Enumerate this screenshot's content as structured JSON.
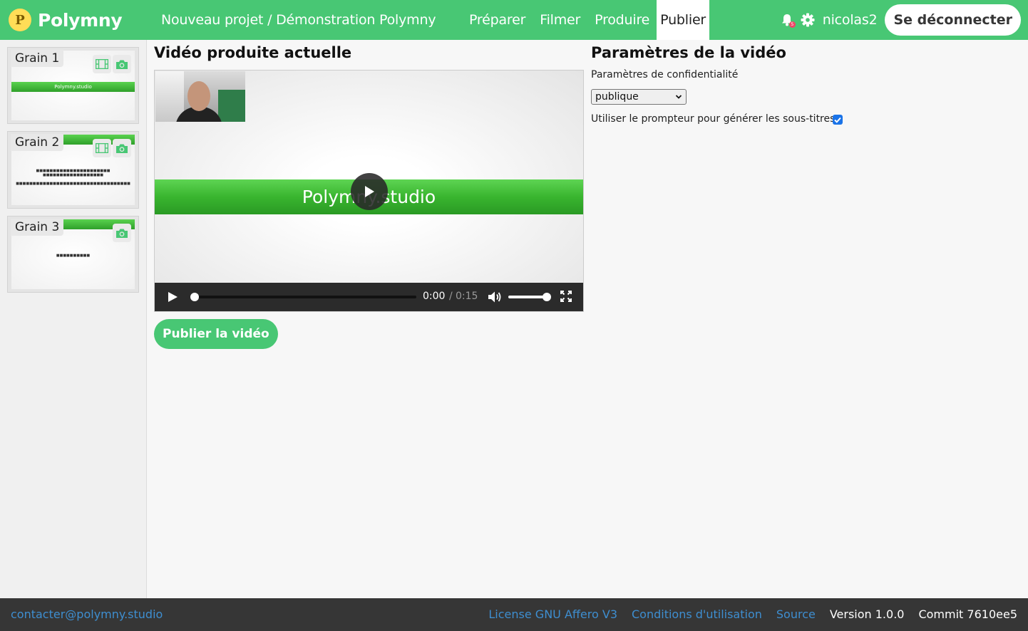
{
  "navbar": {
    "brand_logo": "P",
    "brand": "Polymny",
    "project": "Nouveau projet / Démonstration Polymny",
    "tabs": [
      "Préparer",
      "Filmer",
      "Produire",
      "Publier"
    ],
    "active_tab": "Publier",
    "notification_count": "5",
    "username": "nicolas2",
    "logout": "Se déconnecter",
    "accent_color": "#48c774"
  },
  "sidebar": {
    "grains": [
      {
        "label": "Grain 1",
        "slide_banner": "Polymny.studio",
        "icons": [
          "film-icon",
          "camera-icon"
        ]
      },
      {
        "label": "Grain 2",
        "icons": [
          "film-icon",
          "camera-icon"
        ]
      },
      {
        "label": "Grain 3",
        "icons": [
          "camera-icon"
        ]
      }
    ]
  },
  "main": {
    "title": "Vidéo produite actuelle",
    "video": {
      "slide_banner": "Polymny.studio",
      "time_current": "0:00",
      "time_separator": "/",
      "time_total": "0:15",
      "progress": 0,
      "volume": 1
    },
    "publish_button": "Publier la vidéo"
  },
  "settings": {
    "title": "Paramètres de la vidéo",
    "privacy_label": "Paramètres de confidentialité",
    "privacy_value": "publique",
    "prompter_label": "Utiliser le prompteur pour générer les sous-titres",
    "prompter_checked": true
  },
  "footer": {
    "contact": "contacter@polymny.studio",
    "license": "License GNU Affero V3",
    "terms": "Conditions d'utilisation",
    "source": "Source",
    "version": "Version 1.0.0",
    "commit": "Commit 7610ee5"
  }
}
